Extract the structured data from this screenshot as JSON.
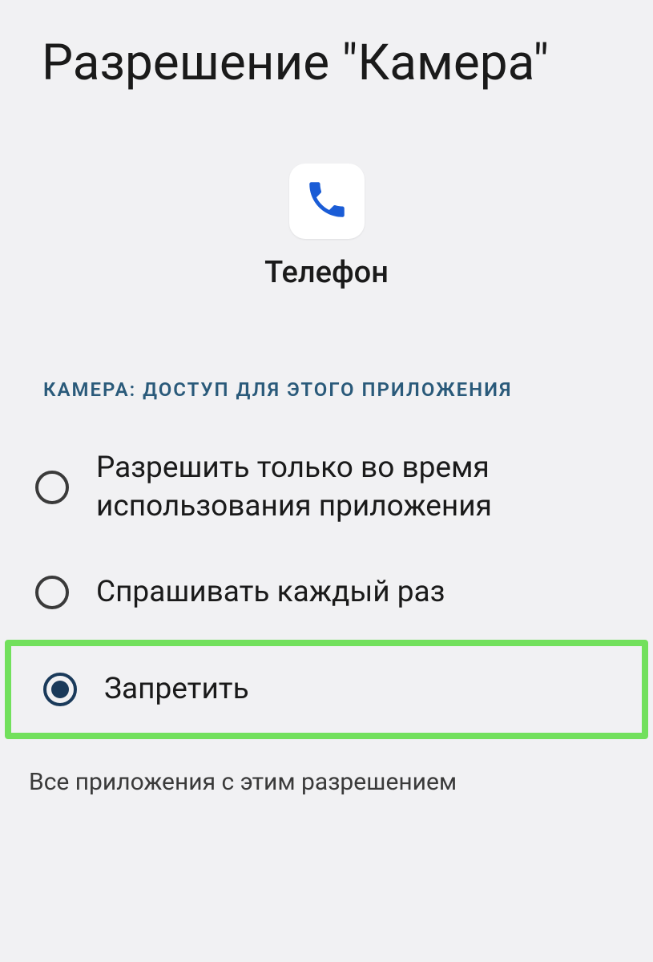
{
  "header": {
    "title": "Разрешение \"Камера\""
  },
  "app": {
    "name": "Телефон",
    "icon": "phone-icon"
  },
  "section": {
    "header": "КАМЕРА: ДОСТУП ДЛЯ ЭТОГО ПРИЛОЖЕНИЯ"
  },
  "options": [
    {
      "label": "Разрешить только во время использования приложения",
      "selected": false,
      "highlighted": false
    },
    {
      "label": "Спрашивать каждый раз",
      "selected": false,
      "highlighted": false
    },
    {
      "label": "Запретить",
      "selected": true,
      "highlighted": true
    }
  ],
  "footer": {
    "link": "Все приложения с этим разрешением"
  }
}
